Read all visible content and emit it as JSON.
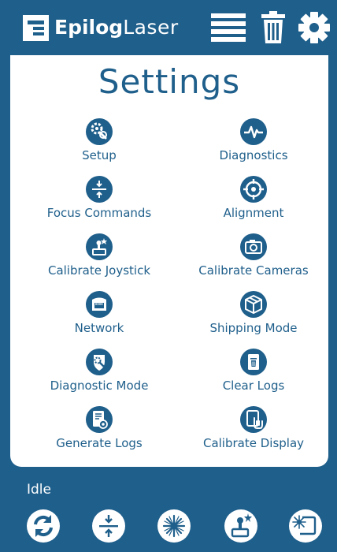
{
  "header": {
    "brand_bold": "Epilog",
    "brand_light": "Laser",
    "icons": [
      "logo-icon",
      "list-icon",
      "trash-icon",
      "gear-icon"
    ]
  },
  "settings": {
    "title": "Settings",
    "items": [
      {
        "label": "Setup",
        "icon": "wrench-gear-icon"
      },
      {
        "label": "Diagnostics",
        "icon": "heartbeat-icon"
      },
      {
        "label": "Focus Commands",
        "icon": "focus-arrows-icon"
      },
      {
        "label": "Alignment",
        "icon": "crosshair-icon"
      },
      {
        "label": "Calibrate Joystick",
        "icon": "joystick-icon"
      },
      {
        "label": "Calibrate Cameras",
        "icon": "camera-icon"
      },
      {
        "label": "Network",
        "icon": "network-icon"
      },
      {
        "label": "Shipping Mode",
        "icon": "shipping-box-icon"
      },
      {
        "label": "Diagnostic Mode",
        "icon": "diagnostic-shield-icon"
      },
      {
        "label": "Clear Logs",
        "icon": "clear-logs-icon"
      },
      {
        "label": "Generate Logs",
        "icon": "generate-logs-icon"
      },
      {
        "label": "Calibrate Display",
        "icon": "calibrate-display-icon"
      }
    ]
  },
  "footer": {
    "status": "Idle",
    "buttons": [
      "refresh-icon",
      "focus-icon",
      "laser-icon",
      "joystick-icon",
      "laser-frame-icon"
    ]
  },
  "colors": {
    "brand_blue": "#1f5f8b",
    "panel_white": "#ffffff"
  }
}
